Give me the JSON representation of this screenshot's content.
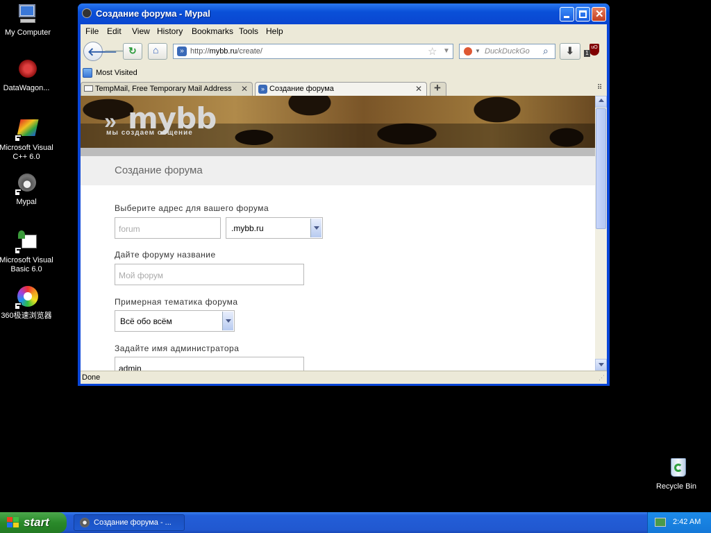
{
  "desktop": {
    "icons": [
      {
        "label": "My Computer"
      },
      {
        "label": "DataWagon..."
      },
      {
        "label": "Microsoft Visual C++ 6.0"
      },
      {
        "label": "Mypal"
      },
      {
        "label": "Microsoft Visual Basic 6.0"
      },
      {
        "label": "360极速浏览器"
      },
      {
        "label": "Recycle Bin"
      }
    ]
  },
  "window": {
    "title": "Создание форума - Mypal",
    "menu": [
      "File",
      "Edit",
      "View",
      "History",
      "Bookmarks",
      "Tools",
      "Help"
    ],
    "url_prefix": "http://",
    "url_domain": "mybb.ru",
    "url_path": "/create/",
    "search_placeholder": "DuckDuckGo",
    "bookmark": "Most Visited",
    "tabs": [
      {
        "label": "TempMail, Free Temporary Mail Address",
        "active": false
      },
      {
        "label": "Создание форума",
        "active": true
      }
    ],
    "new_tab_symbol": "+",
    "status": "Done"
  },
  "page": {
    "logo_arrows": "»",
    "logo": "mybb",
    "tagline": "мы  создаем  общение",
    "heading": "Создание форума",
    "fields": {
      "address_label": "Выберите адрес для вашего форума",
      "address_placeholder": "forum",
      "domain_value": ".mybb.ru",
      "name_label": "Дайте форуму название",
      "name_placeholder": "Мой форум",
      "topic_label": "Примерная тематика форума",
      "topic_value": "Всё обо всём",
      "admin_label": "Задайте имя администратора",
      "admin_value": "admin"
    }
  },
  "taskbar": {
    "start": "start",
    "task": "Создание форума - ...",
    "clock": "2:42 AM"
  }
}
